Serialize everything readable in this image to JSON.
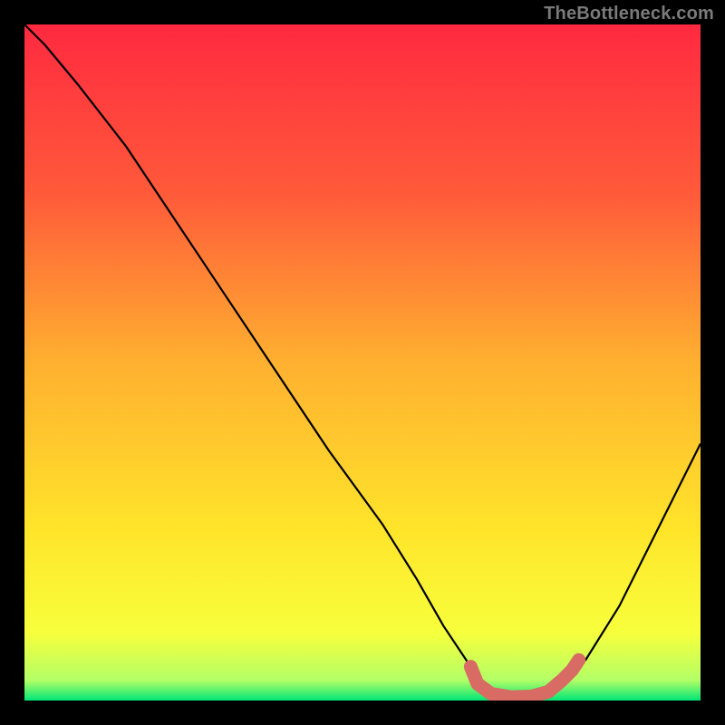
{
  "watermark": "TheBottleneck.com",
  "chart_data": {
    "type": "line",
    "title": "",
    "xlabel": "",
    "ylabel": "",
    "xlim": [
      0,
      100
    ],
    "ylim": [
      0,
      100
    ],
    "gradient_stops": [
      {
        "offset": 0.0,
        "color": "#ff2940"
      },
      {
        "offset": 0.25,
        "color": "#ff5a3a"
      },
      {
        "offset": 0.5,
        "color": "#ffb030"
      },
      {
        "offset": 0.75,
        "color": "#ffe52a"
      },
      {
        "offset": 0.9,
        "color": "#f7ff3c"
      },
      {
        "offset": 0.97,
        "color": "#b3ff66"
      },
      {
        "offset": 1.0,
        "color": "#00e676"
      }
    ],
    "series": [
      {
        "name": "bottleneck-curve",
        "x": [
          0.0,
          3.0,
          8.0,
          15.0,
          25.0,
          35.0,
          45.0,
          53.0,
          58.0,
          62.0,
          66.0,
          69.0,
          73.0,
          78.0,
          83.0,
          88.0,
          93.0,
          97.0,
          100.0
        ],
        "y": [
          100.0,
          97.0,
          91.0,
          82.0,
          67.0,
          52.0,
          37.0,
          26.0,
          18.0,
          11.0,
          5.0,
          1.0,
          0.5,
          1.5,
          6.0,
          14.0,
          24.0,
          32.0,
          38.0
        ]
      },
      {
        "name": "optimal-flat",
        "x": [
          66.0,
          67.0,
          69.0,
          72.0,
          75.0,
          77.5,
          79.5,
          81.0,
          82.0
        ],
        "y": [
          5.0,
          2.5,
          1.0,
          0.5,
          0.6,
          1.3,
          3.0,
          4.5,
          6.0
        ]
      }
    ],
    "optimal_color": "#d86b64",
    "optimal_stroke_width": 15
  }
}
